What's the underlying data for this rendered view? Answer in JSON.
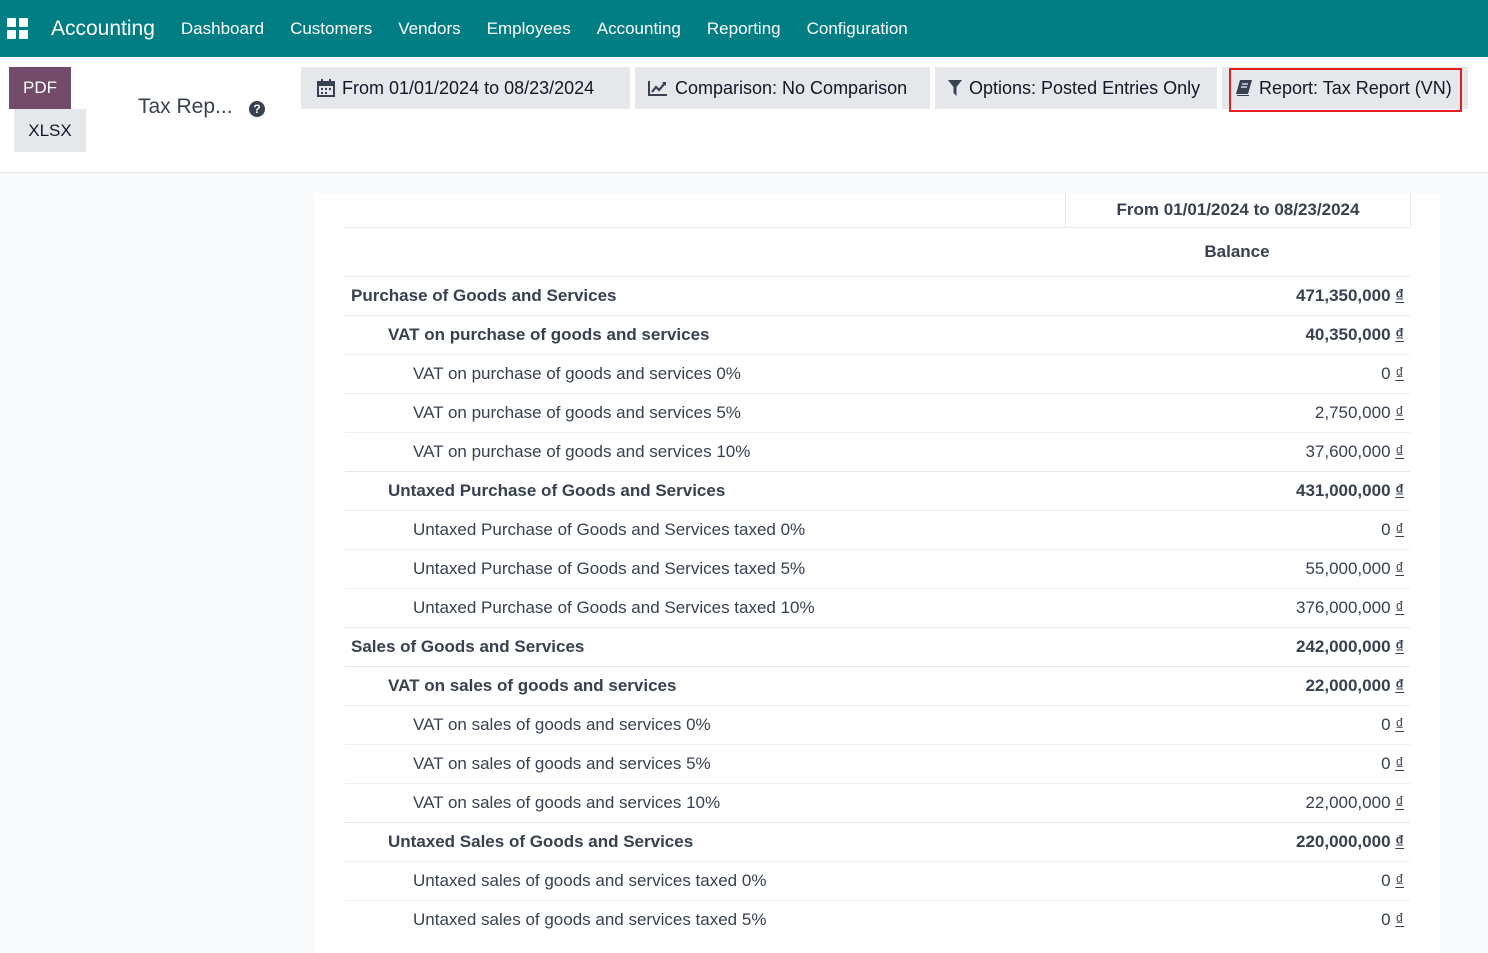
{
  "nav": {
    "brand": "Accounting",
    "items": [
      "Dashboard",
      "Customers",
      "Vendors",
      "Employees",
      "Accounting",
      "Reporting",
      "Configuration"
    ]
  },
  "control": {
    "pdf_label": "PDF",
    "xlsx_label": "XLSX",
    "page_title": "Tax Rep...",
    "filters": {
      "date": "From 01/01/2024 to 08/23/2024",
      "comparison": "Comparison: No Comparison",
      "options": "Options: Posted Entries Only",
      "report": "Report: Tax Report (VN)"
    }
  },
  "report": {
    "period_header": "From 01/01/2024 to 08/23/2024",
    "balance_header": "Balance",
    "currency": "₫",
    "rows": [
      {
        "level": 0,
        "name": "Purchase of Goods and Services",
        "amount": "471,350,000"
      },
      {
        "level": 1,
        "name": "VAT on purchase of goods and services",
        "amount": "40,350,000"
      },
      {
        "level": 2,
        "name": "VAT on purchase of goods and services 0%",
        "amount": "0"
      },
      {
        "level": 2,
        "name": "VAT on purchase of goods and services 5%",
        "amount": "2,750,000"
      },
      {
        "level": 2,
        "name": "VAT on purchase of goods and services 10%",
        "amount": "37,600,000"
      },
      {
        "level": 1,
        "name": "Untaxed Purchase of Goods and Services",
        "amount": "431,000,000"
      },
      {
        "level": 2,
        "name": "Untaxed Purchase of Goods and Services taxed 0%",
        "amount": "0"
      },
      {
        "level": 2,
        "name": "Untaxed Purchase of Goods and Services taxed 5%",
        "amount": "55,000,000"
      },
      {
        "level": 2,
        "name": "Untaxed Purchase of Goods and Services taxed 10%",
        "amount": "376,000,000"
      },
      {
        "level": 0,
        "name": "Sales of Goods and Services",
        "amount": "242,000,000"
      },
      {
        "level": 1,
        "name": "VAT on sales of goods and services",
        "amount": "22,000,000"
      },
      {
        "level": 2,
        "name": "VAT on sales of goods and services 0%",
        "amount": "0"
      },
      {
        "level": 2,
        "name": "VAT on sales of goods and services 5%",
        "amount": "0"
      },
      {
        "level": 2,
        "name": "VAT on sales of goods and services 10%",
        "amount": "22,000,000"
      },
      {
        "level": 1,
        "name": "Untaxed Sales of Goods and Services",
        "amount": "220,000,000"
      },
      {
        "level": 2,
        "name": "Untaxed sales of goods and services taxed 0%",
        "amount": "0"
      },
      {
        "level": 2,
        "name": "Untaxed sales of goods and services taxed 5%",
        "amount": "0"
      }
    ]
  },
  "colors": {
    "nav_bg": "#017e84",
    "primary_button": "#714b67",
    "highlight_border": "#e02020"
  }
}
